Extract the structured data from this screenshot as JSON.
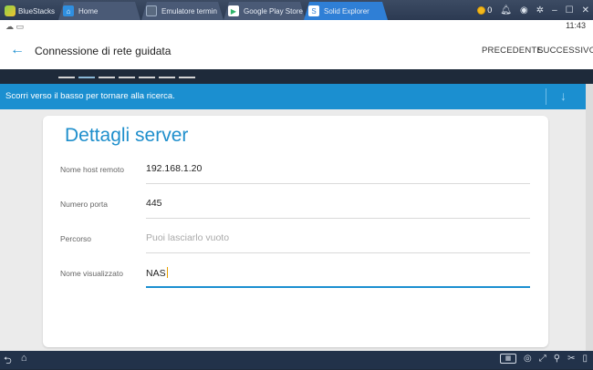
{
  "window": {
    "tabs": [
      {
        "label": "BlueStacks",
        "icon": "bluestacks-logo-icon"
      },
      {
        "label": "Home",
        "icon": "home-icon"
      },
      {
        "label": "Emulatore termin",
        "icon": "terminal-icon"
      },
      {
        "label": "Google Play Store",
        "icon": "play-store-icon"
      },
      {
        "label": "Solid Explorer",
        "icon": "solid-explorer-icon"
      }
    ],
    "coins": "0"
  },
  "statusbar": {
    "time": "11:43"
  },
  "appbar": {
    "title": "Connessione di rete guidata",
    "prev": "PRECEDENTE",
    "next": "SUCCESSIVO"
  },
  "progress": {
    "steps": 7,
    "current": 2
  },
  "banner": {
    "text": "Scorri verso il basso per tornare alla ricerca."
  },
  "card": {
    "title": "Dettagli server",
    "fields": [
      {
        "label": "Nome host remoto",
        "value": "192.168.1.20",
        "placeholder": ""
      },
      {
        "label": "Numero porta",
        "value": "445",
        "placeholder": ""
      },
      {
        "label": "Percorso",
        "value": "",
        "placeholder": "Puoi lasciarlo vuoto"
      },
      {
        "label": "Nome visualizzato",
        "value": "NAS",
        "placeholder": ""
      }
    ]
  },
  "colors": {
    "accent": "#1b8fd0",
    "title": "#1f8fcc",
    "topbar": "#2c3a52"
  }
}
